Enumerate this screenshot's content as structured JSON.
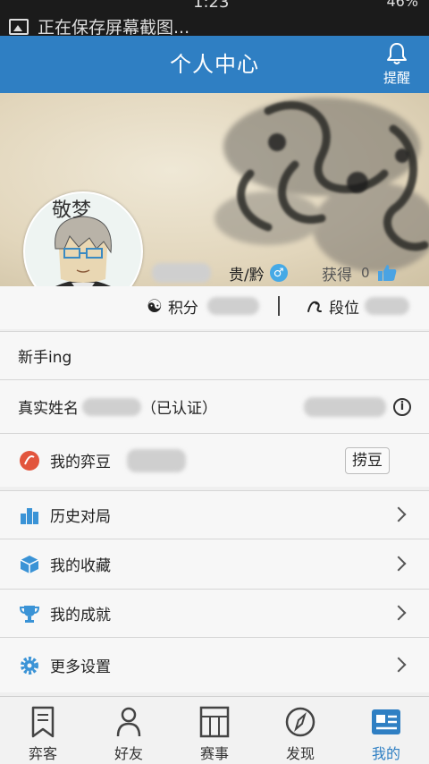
{
  "status_bar": {
    "notification": "正在保存屏幕截图...",
    "time": "1:23",
    "battery": "46%"
  },
  "header": {
    "title": "个人中心",
    "remind_label": "提醒"
  },
  "profile": {
    "location": "贵/黔",
    "gain_label": "获得",
    "gain_count": "0",
    "avatar_text": "敬梦"
  },
  "stats": {
    "points_label": "积分",
    "rank_label": "段位"
  },
  "rows": {
    "bio": "新手ing",
    "realname_label": "真实姓名",
    "realname_status": "（已认证）",
    "beans_label": "我的弈豆",
    "beans_button": "捞豆",
    "history_label": "历史对局",
    "favorites_label": "我的收藏",
    "achievements_label": "我的成就",
    "settings_label": "更多设置"
  },
  "tabs": [
    {
      "label": "弈客",
      "icon": "bookmark-icon"
    },
    {
      "label": "好友",
      "icon": "person-icon"
    },
    {
      "label": "赛事",
      "icon": "board-icon"
    },
    {
      "label": "发现",
      "icon": "compass-icon"
    },
    {
      "label": "我的",
      "icon": "id-card-icon",
      "active": true
    }
  ],
  "colors": {
    "header": "#2f7fc3",
    "active_tab": "#2f7fc3",
    "bean_icon": "#e2553d",
    "menu_icon": "#3a93d6"
  }
}
